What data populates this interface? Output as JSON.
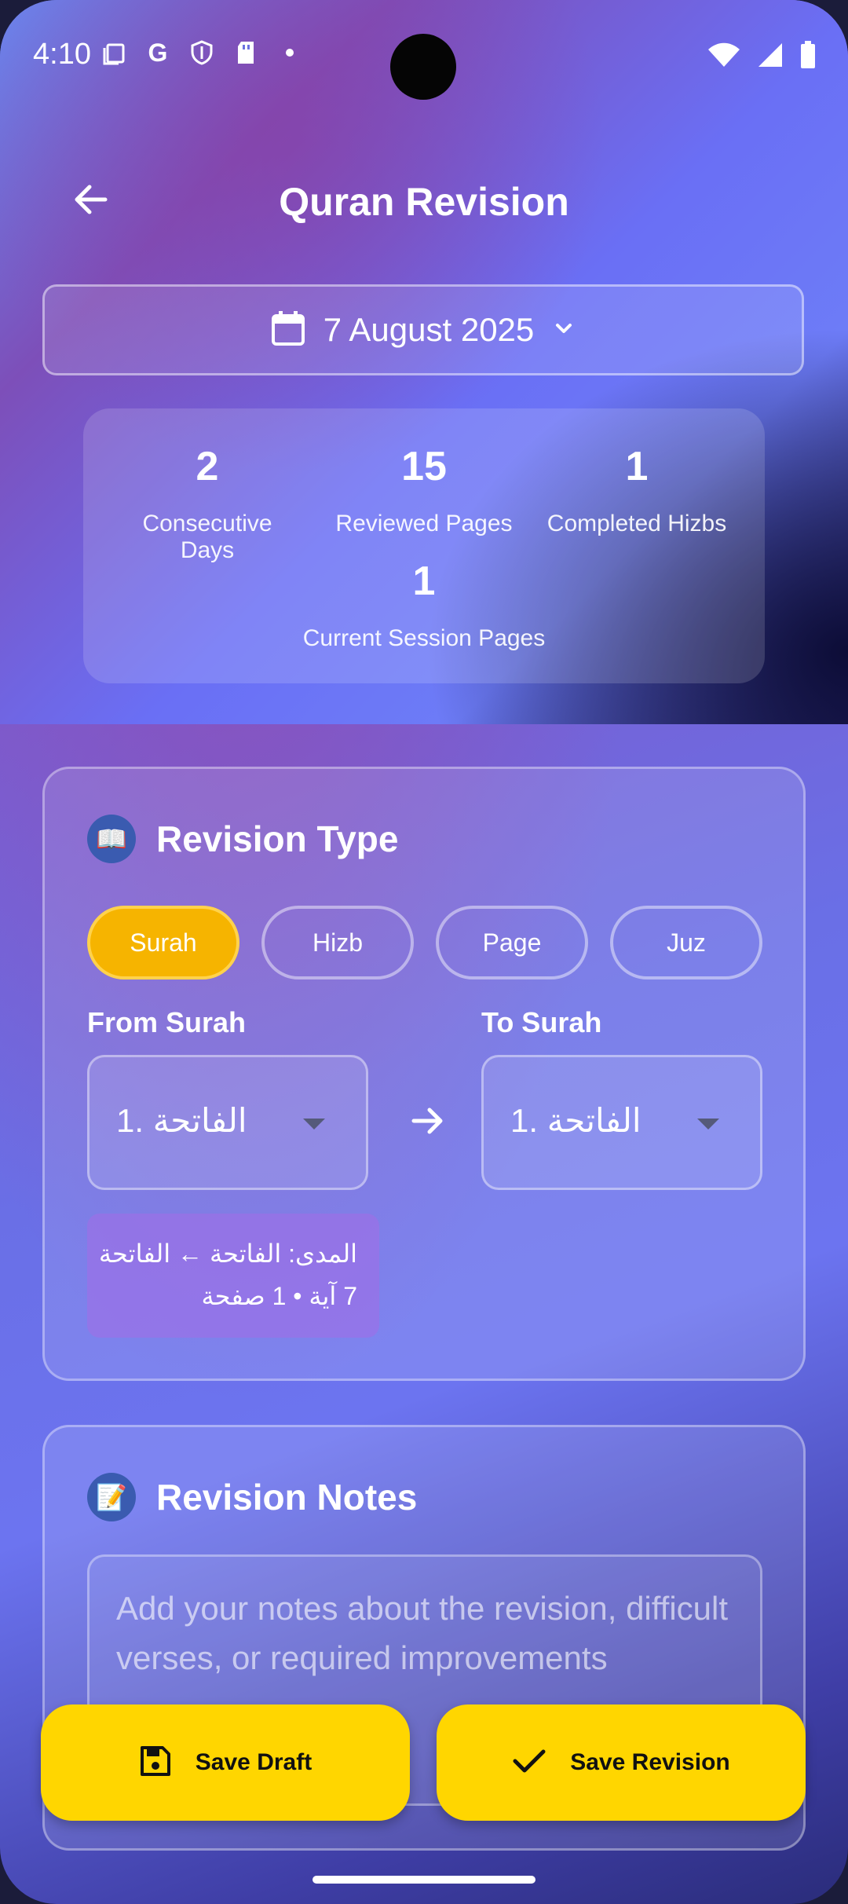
{
  "status_bar": {
    "time": "4:10"
  },
  "header": {
    "title": "Quran Revision"
  },
  "date_selector": {
    "label": "7 August 2025"
  },
  "stats": [
    {
      "value": "2",
      "label": "Consecutive Days"
    },
    {
      "value": "15",
      "label": "Reviewed Pages"
    },
    {
      "value": "1",
      "label": "Completed Hizbs"
    },
    {
      "value": "1",
      "label": "Current Session Pages"
    }
  ],
  "revision_type": {
    "icon": "📖",
    "title": "Revision Type",
    "options": [
      "Surah",
      "Hizb",
      "Page",
      "Juz"
    ],
    "selected": "Surah",
    "from_label": "From Surah",
    "from_value": "1. الفاتحة",
    "to_label": "To Surah",
    "to_value": "1. الفاتحة",
    "range_line1": "المدى: الفاتحة ← الفاتحة",
    "range_line2": "7 آية • 1 صفحة",
    "accent_color": "#f6b400"
  },
  "notes": {
    "icon": "📝",
    "title": "Revision Notes",
    "placeholder": "Add your notes about the revision, difficult verses, or required improvements"
  },
  "actions": {
    "save_draft": "Save Draft",
    "save_revision": "Save Revision",
    "button_color": "#ffd600"
  }
}
